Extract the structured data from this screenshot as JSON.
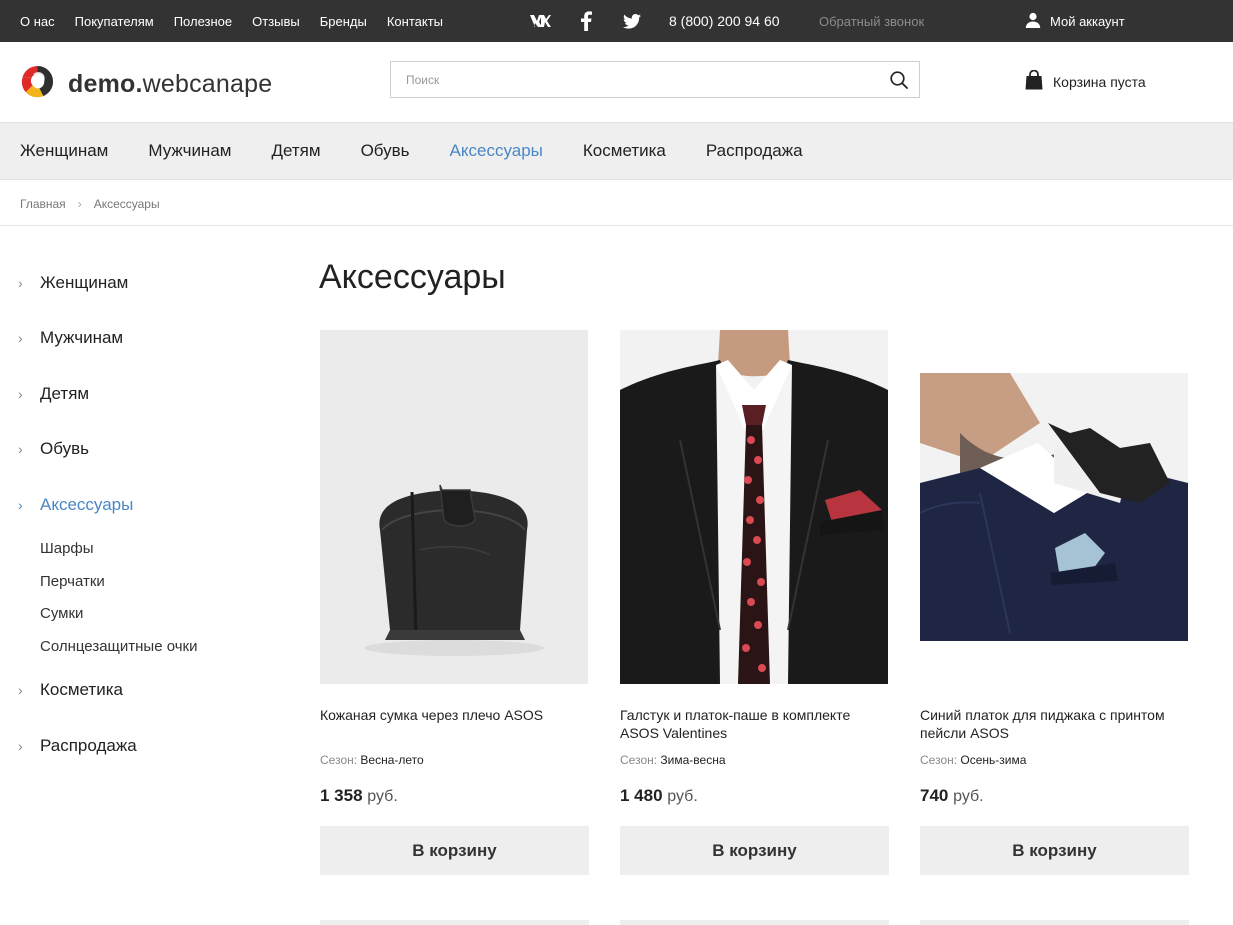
{
  "topbar": {
    "links": [
      "О нас",
      "Покупателям",
      "Полезное",
      "Отзывы",
      "Бренды",
      "Контакты"
    ],
    "social_icons": [
      "vk-icon",
      "facebook-icon",
      "twitter-icon"
    ],
    "phone": "8 (800) 200 94 60",
    "callback": "Обратный звонок",
    "account": "Мой аккаунт"
  },
  "header": {
    "logo_bold": "demo.",
    "logo_light": "webcanape",
    "search_placeholder": "Поиск",
    "cart_label": "Корзина пуста"
  },
  "nav": {
    "items": [
      "Женщинам",
      "Мужчинам",
      "Детям",
      "Обувь",
      "Аксессуары",
      "Косметика",
      "Распродажа"
    ],
    "active": "Аксессуары"
  },
  "breadcrumb": {
    "home": "Главная",
    "current": "Аксессуары"
  },
  "sidebar": {
    "items": [
      "Женщинам",
      "Мужчинам",
      "Детям",
      "Обувь",
      "Аксессуары",
      "Косметика",
      "Распродажа"
    ],
    "active": "Аксессуары",
    "subitems": [
      "Шарфы",
      "Перчатки",
      "Сумки",
      "Солнцезащитные очки"
    ]
  },
  "page_title": "Аксессуары",
  "products": [
    {
      "name": "Кожаная сумка через плечо ASOS",
      "season_label": "Сезон:",
      "season": "Весна-лето",
      "price": "1 358",
      "currency": "руб.",
      "button": "В корзину"
    },
    {
      "name": "Галстук и платок-паше в комплекте ASOS Valentines",
      "season_label": "Сезон:",
      "season": "Зима-весна",
      "price": "1 480",
      "currency": "руб.",
      "button": "В корзину"
    },
    {
      "name": "Синий платок для пиджака с принтом пейсли ASOS",
      "season_label": "Сезон:",
      "season": "Осень-зима",
      "price": "740",
      "currency": "руб.",
      "button": "В корзину"
    }
  ],
  "colors": {
    "topbar_bg": "#333333",
    "accent": "#4a87c5",
    "nav_bg": "#efefef",
    "button_bg": "#eeeeee"
  }
}
